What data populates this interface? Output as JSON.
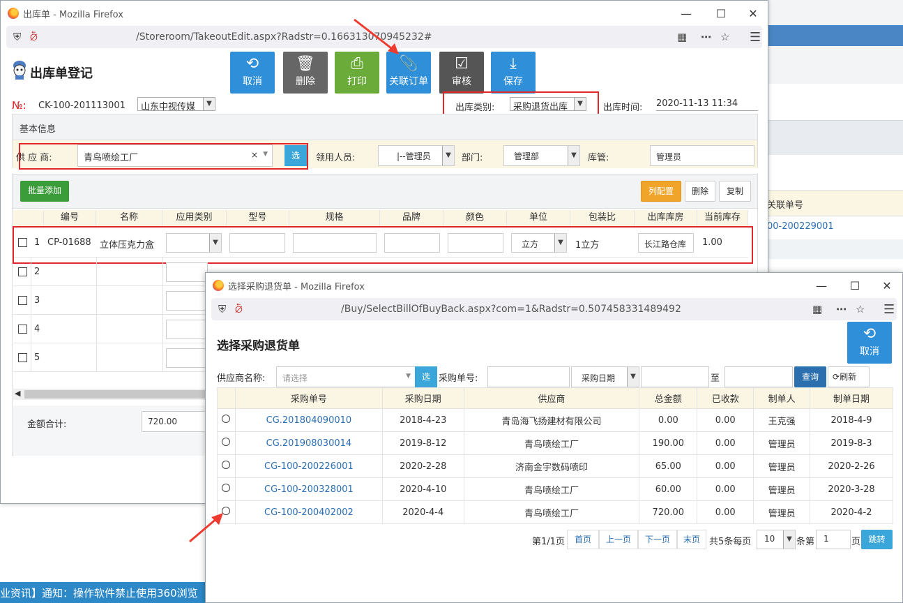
{
  "background": {
    "col_header": "关联单号",
    "col_value": "00-200229001",
    "notice": "业资讯】通知：操作软件禁止使用360浏览"
  },
  "window1": {
    "title": "出库单 - Mozilla Firefox",
    "url": "/Storeroom/TakeoutEdit.aspx?Radstr=0.166313070945232#",
    "page_title": "出库单登记",
    "toolbar": {
      "cancel": "取消",
      "delete": "删除",
      "print": "打印",
      "link_order": "关联订单",
      "review": "审核",
      "save": "保存"
    },
    "no_label": "№:",
    "no_value": "CK-100-201113001",
    "company": "山东中视传媒",
    "out_type_label": "出库类别:",
    "out_type_value": "采购退货出库",
    "out_time_label": "出库时间:",
    "out_time_value": "2020-11-13 11:34",
    "basic_info": "基本信息",
    "supplier_label": "供 应 商:",
    "supplier_value": "青鸟喷绘工厂",
    "select_btn": "选",
    "receiver_label": "领用人员:",
    "receiver_value": "|--管理员",
    "dept_label": "部门:",
    "dept_value": "管理部",
    "keeper_label": "库管:",
    "keeper_value": "管理员",
    "batch_add": "批量添加",
    "col_config": "列配置",
    "del_btn": "删除",
    "copy_btn": "复制",
    "columns": [
      "编号",
      "名称",
      "应用类别",
      "型号",
      "规格",
      "品牌",
      "颜色",
      "单位",
      "包装比",
      "出库库房",
      "当前库存"
    ],
    "rows": [
      {
        "idx": "1",
        "code": "CP-01688",
        "name": "立体压克力盒",
        "unit": "立方",
        "pack": "1立方",
        "warehouse": "长江路仓库",
        "stock": "1.00"
      },
      {
        "idx": "2"
      },
      {
        "idx": "3"
      },
      {
        "idx": "4"
      },
      {
        "idx": "5"
      }
    ],
    "total_label": "金额合计:",
    "total_value": "720.00"
  },
  "window2": {
    "title": "选择采购退货单 - Mozilla Firefox",
    "url": "/Buy/SelectBillOfBuyBack.aspx?com=1&Radstr=0.507458331489492",
    "page_title": "选择采购退货单",
    "cancel": "取消",
    "supplier_label": "供应商名称:",
    "supplier_placeholder": "请选择",
    "select_btn": "选",
    "po_label": "采购单号:",
    "date_select": "采购日期",
    "to_label": "至",
    "query_btn": "查询",
    "refresh_btn": "刷新",
    "columns": [
      "采购单号",
      "采购日期",
      "供应商",
      "总金额",
      "已收款",
      "制单人",
      "制单日期"
    ],
    "rows": [
      [
        "CG.201804090010",
        "2018-4-23",
        "青岛海飞扬建材有限公司",
        "0.00",
        "0.00",
        "王克强",
        "2018-4-9"
      ],
      [
        "CG.201908030014",
        "2019-8-12",
        "青鸟喷绘工厂",
        "190.00",
        "0.00",
        "管理员",
        "2019-8-3"
      ],
      [
        "CG-100-200226001",
        "2020-2-28",
        "济南金宇数码喷印",
        "65.00",
        "0.00",
        "管理员",
        "2020-2-26"
      ],
      [
        "CG-100-200328001",
        "2020-4-10",
        "青鸟喷绘工厂",
        "60.00",
        "0.00",
        "管理员",
        "2020-3-28"
      ],
      [
        "CG-100-200402002",
        "2020-4-4",
        "青鸟喷绘工厂",
        "720.00",
        "0.00",
        "管理员",
        "2020-4-2"
      ]
    ],
    "pager": {
      "page_info": "第1/1页",
      "first": "首页",
      "prev": "上一页",
      "next": "下一页",
      "last": "末页",
      "summary": "共5条每页",
      "page_size": "10",
      "jump_prefix": "条第",
      "jump_value": "1",
      "jump_suffix": "页",
      "jump_btn": "跳转"
    }
  }
}
